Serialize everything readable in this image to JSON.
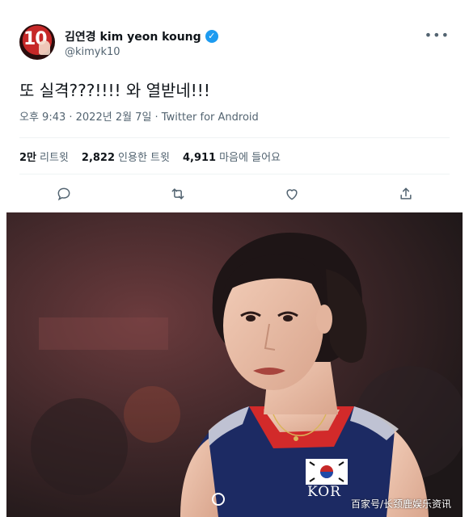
{
  "author": {
    "avatar_text": "10",
    "display_name": "김연경 kim yeon koung",
    "handle": "@kimyk10",
    "verified": true
  },
  "tweet": {
    "text": "또 실격???!!!! 와 열받네!!!",
    "timestamp": "오후 9:43 · 2022년 2월 7일 · Twitter for Android"
  },
  "stats": {
    "retweets_count": "2만",
    "retweets_label": "리트윗",
    "quotes_count": "2,822",
    "quotes_label": "인용한 트윗",
    "likes_count": "4,911",
    "likes_label": "마음에 들어요"
  },
  "actions": [
    "reply-icon",
    "retweet-icon",
    "like-icon",
    "share-icon"
  ],
  "photo": {
    "jersey_label": "KOR"
  },
  "watermark": "百家号/长颈鹿娱乐资讯",
  "colors": {
    "verified": "#1d9bf0",
    "secondary_text": "#536471",
    "jersey_navy": "#1c2a63",
    "jersey_red": "#d22a2a"
  }
}
